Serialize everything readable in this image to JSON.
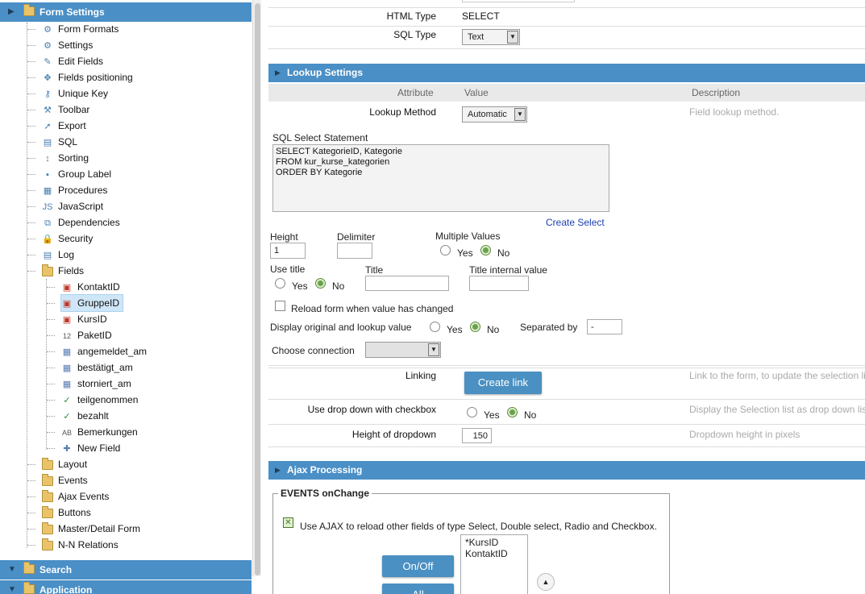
{
  "tree": {
    "form_settings": "Form Settings",
    "items": [
      {
        "label": "Form Formats",
        "icon": "gear-icon",
        "glyph": "⚙"
      },
      {
        "label": "Settings",
        "icon": "gear-icon",
        "glyph": "⚙"
      },
      {
        "label": "Edit Fields",
        "icon": "pencil-icon",
        "glyph": "✎"
      },
      {
        "label": "Fields positioning",
        "icon": "move-icon",
        "glyph": "✥"
      },
      {
        "label": "Unique Key",
        "icon": "key-icon",
        "glyph": "⚷"
      },
      {
        "label": "Toolbar",
        "icon": "tools-icon",
        "glyph": "⚒"
      },
      {
        "label": "Export",
        "icon": "export-arrow-icon",
        "glyph": "➚"
      },
      {
        "label": "SQL",
        "icon": "database-icon",
        "glyph": "▤"
      },
      {
        "label": "Sorting",
        "icon": "sort-icon",
        "glyph": "↕"
      },
      {
        "label": "Group Label",
        "icon": "group-label-icon",
        "glyph": "▪"
      },
      {
        "label": "Procedures",
        "icon": "procedures-icon",
        "glyph": "▦"
      },
      {
        "label": "JavaScript",
        "icon": "javascript-icon",
        "glyph": "JS"
      },
      {
        "label": "Dependencies",
        "icon": "dependencies-icon",
        "glyph": "⧉"
      },
      {
        "label": "Security",
        "icon": "lock-icon",
        "glyph": "🔒"
      },
      {
        "label": "Log",
        "icon": "log-icon",
        "glyph": "▤"
      },
      {
        "label": "Fields",
        "icon": "folder-icon",
        "glyph": ""
      }
    ],
    "fields": [
      {
        "label": "KontaktID",
        "icon": "select-field-icon",
        "glyph": "▣"
      },
      {
        "label": "GruppeID",
        "icon": "select-field-icon",
        "glyph": "▣"
      },
      {
        "label": "KursID",
        "icon": "select-field-icon",
        "glyph": "▣"
      },
      {
        "label": "PaketID",
        "icon": "number-field-icon",
        "glyph": "12"
      },
      {
        "label": "angemeldet_am",
        "icon": "date-field-icon",
        "glyph": "▦"
      },
      {
        "label": "bestätigt_am",
        "icon": "date-field-icon",
        "glyph": "▦"
      },
      {
        "label": "storniert_am",
        "icon": "date-field-icon",
        "glyph": "▦"
      },
      {
        "label": "teilgenommen",
        "icon": "checkmark-icon",
        "glyph": "✓"
      },
      {
        "label": "bezahlt",
        "icon": "checkmark-icon",
        "glyph": "✓"
      },
      {
        "label": "Bemerkungen",
        "icon": "text-field-icon",
        "glyph": "AB"
      },
      {
        "label": "New Field",
        "icon": "plus-icon",
        "glyph": "✚"
      }
    ],
    "folders": [
      "Layout",
      "Events",
      "Ajax Events",
      "Buttons",
      "Master/Detail Form",
      "N-N Relations"
    ],
    "search": "Search",
    "application": "Application"
  },
  "main": {
    "html_type_label": "HTML Type",
    "html_type_value": "SELECT",
    "sql_type_label": "SQL Type",
    "sql_type_value": "Text",
    "lookup": {
      "header": "Lookup Settings",
      "col_attribute": "Attribute",
      "col_value": "Value",
      "col_description": "Description",
      "method_label": "Lookup Method",
      "method_value": "Automatic",
      "method_desc": "Field lookup method.",
      "sql_label": "SQL Select Statement",
      "sql_text": "SELECT KategorieID, Kategorie\nFROM kur_kurse_kategorien\nORDER BY Kategorie",
      "create_select": "Create Select",
      "height_label": "Height",
      "height_value": "1",
      "delimiter_label": "Delimiter",
      "delimiter_value": "",
      "multiple_label": "Multiple Values",
      "yes": "Yes",
      "no": "No",
      "use_title_label": "Use title",
      "title_label": "Title",
      "title_value": "",
      "title_internal_label": "Title internal value",
      "title_internal_value": "",
      "reload_label": "Reload form when value has changed",
      "display_orig_label": "Display original and lookup value",
      "separated_label": "Separated by",
      "separated_value": "-",
      "choose_conn_label": "Choose connection",
      "choose_conn_value": "",
      "linking_label": "Linking",
      "create_link": "Create link",
      "linking_desc": "Link to the form, to update the selection list",
      "dropdown_cb_label": "Use drop down with checkbox",
      "dropdown_cb_desc": "Display the Selection list as drop down list",
      "dropdown_height_label": "Height of dropdown",
      "dropdown_height_value": "150",
      "dropdown_height_desc": "Dropdown height in pixels"
    },
    "ajax": {
      "header": "Ajax Processing",
      "legend": "EVENTS onChange",
      "use_ajax": "Use AJAX to reload other fields of type Select, Double select, Radio and Checkbox.",
      "on_off": "On/Off",
      "all": "All",
      "list": [
        "*KursID",
        "KontaktID"
      ]
    }
  }
}
